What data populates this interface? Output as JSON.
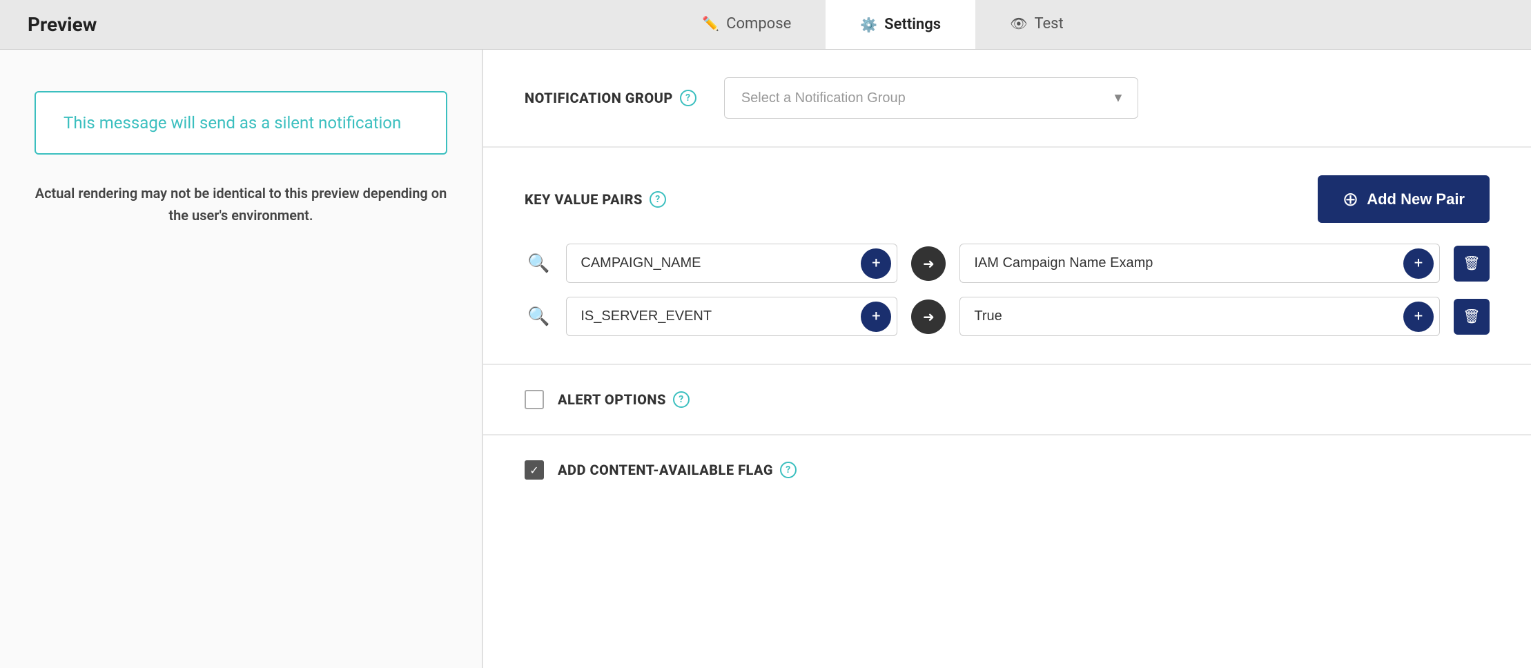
{
  "header": {
    "preview_title": "Preview",
    "tabs": [
      {
        "id": "compose",
        "label": "Compose",
        "icon": "✏️",
        "active": false
      },
      {
        "id": "settings",
        "label": "Settings",
        "icon": "⚙️",
        "active": true
      },
      {
        "id": "test",
        "label": "Test",
        "icon": "👁",
        "active": false
      }
    ]
  },
  "left_panel": {
    "silent_notification_text": "This message will send as a silent notification",
    "rendering_note_line1": "Actual rendering may not be identical to this preview depending on",
    "rendering_note_line2": "the user's environment."
  },
  "right_panel": {
    "notification_group": {
      "label": "NOTIFICATION GROUP",
      "help_tooltip": "?",
      "select_placeholder": "Select a Notification Group",
      "options": []
    },
    "key_value_pairs": {
      "label": "KEY VALUE PAIRS",
      "help_tooltip": "?",
      "add_button_label": "Add New Pair",
      "rows": [
        {
          "key": "CAMPAIGN_NAME",
          "value": "IAM Campaign Name Examp",
          "key_placeholder": "CAMPAIGN_NAME",
          "value_placeholder": "IAM Campaign Name Examp"
        },
        {
          "key": "IS_SERVER_EVENT",
          "value": "True",
          "key_placeholder": "IS_SERVER_EVENT",
          "value_placeholder": "True"
        }
      ]
    },
    "alert_options": {
      "label": "ALERT OPTIONS",
      "help_tooltip": "?",
      "checked": false
    },
    "content_available_flag": {
      "label": "ADD CONTENT-AVAILABLE FLAG",
      "help_tooltip": "?",
      "checked": true
    }
  }
}
